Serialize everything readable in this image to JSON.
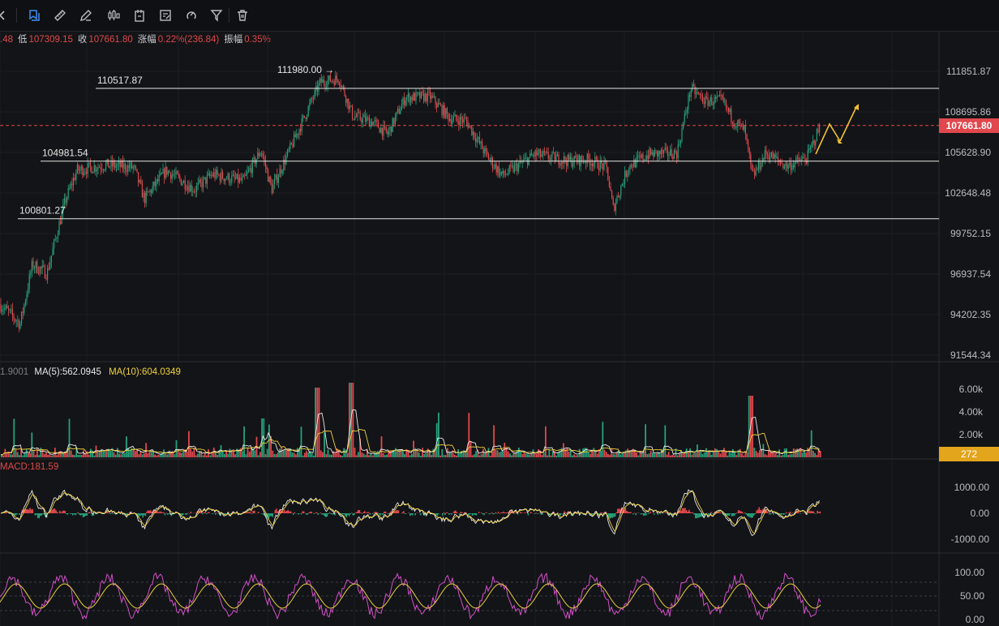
{
  "toolbar": {
    "tools": [
      {
        "name": "draw-box-icon",
        "active": true
      },
      {
        "name": "ruler-icon",
        "active": false
      },
      {
        "name": "pencil-icon",
        "active": false
      },
      {
        "name": "candlestick-icon",
        "active": false
      },
      {
        "name": "document-icon",
        "active": false
      },
      {
        "name": "note-edit-icon",
        "active": false
      },
      {
        "name": "magnet-icon",
        "active": false
      },
      {
        "name": "filter-icon",
        "active": false
      },
      {
        "name": "trash-icon",
        "active": false
      }
    ]
  },
  "ohlc": {
    "high_partial": ".48",
    "low_label": "低",
    "low": "107309.15",
    "close_label": "收",
    "close": "107661.80",
    "change_label": "涨幅",
    "change": "0.22%(236.84)",
    "amplitude_label": "振幅",
    "amplitude": "0.35%"
  },
  "price_axis": {
    "ticks": [
      "111851.87",
      "108695.86",
      "105628.90",
      "102648.48",
      "99752.15",
      "96937.54",
      "94202.35",
      "91544.34"
    ],
    "current_price": "107661.80",
    "current_price_color": "#e0484e"
  },
  "levels": [
    {
      "label": "110517.87",
      "price": 110517.87
    },
    {
      "label": "104981.54",
      "price": 104981.54
    },
    {
      "label": "100801.27",
      "price": 100801.27
    }
  ],
  "high_annotation": "111980.00",
  "high_arrow": "→",
  "volume_panel": {
    "partial_label": "1.9001",
    "ma5_label": "MA(5):562.0945",
    "ma10_label": "MA(10):604.0349",
    "ticks": [
      "6.00k",
      "4.00k",
      "2.00k"
    ],
    "current": "272",
    "current_color": "#e2a51b"
  },
  "macd_panel": {
    "label": "MACD:181.59",
    "ticks": [
      "1000.00",
      "0.00",
      "-1000.00"
    ]
  },
  "osc_panel": {
    "ticks": [
      "100.00",
      "50.00",
      "0.00"
    ]
  },
  "colors": {
    "up": "#26a17b",
    "down": "#e0484e",
    "projection": "#f2c12e",
    "ma5": "#e8e8e8",
    "ma10": "#f2d23c",
    "osc_k": "#d24fc9",
    "osc_d": "#e8cf3c"
  }
}
